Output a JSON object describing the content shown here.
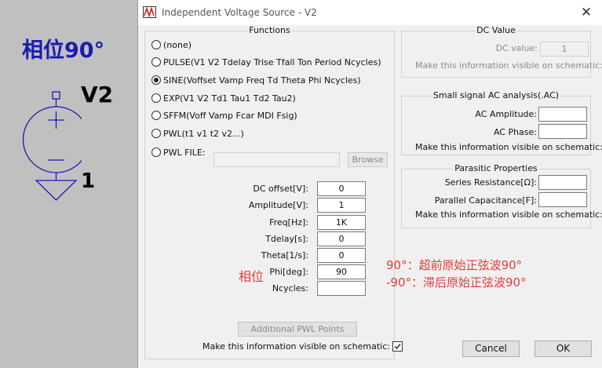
{
  "schematic": {
    "phase_label": "相位90°",
    "ref_designator": "V2",
    "node_label": "1"
  },
  "dialog": {
    "title": "Independent Voltage Source - V2",
    "close_glyph": "✕",
    "functions": {
      "title": "Functions",
      "options": [
        {
          "label": "(none)",
          "checked": false
        },
        {
          "label": "PULSE(V1 V2 Tdelay Trise Tfall Ton Period Ncycles)",
          "checked": false
        },
        {
          "label": "SINE(Voffset Vamp Freq Td Theta Phi Ncycles)",
          "checked": true
        },
        {
          "label": "EXP(V1 V2 Td1 Tau1 Td2 Tau2)",
          "checked": false
        },
        {
          "label": "SFFM(Voff Vamp Fcar MDI Fsig)",
          "checked": false
        },
        {
          "label": "PWL(t1 v1 t2 v2...)",
          "checked": false
        },
        {
          "label": "PWL FILE:",
          "checked": false
        }
      ],
      "browse_label": "Browse",
      "params": [
        {
          "label": "DC offset[V]:",
          "value": "0"
        },
        {
          "label": "Amplitude[V]:",
          "value": "1"
        },
        {
          "label": "Freq[Hz]:",
          "value": "1K"
        },
        {
          "label": "Tdelay[s]:",
          "value": "0"
        },
        {
          "label": "Theta[1/s]:",
          "value": "0"
        },
        {
          "label": "Phi[deg]:",
          "value": "90"
        },
        {
          "label": "Ncycles:",
          "value": ""
        }
      ],
      "additional_pwl_label": "Additional PWL Points",
      "visible_label": "Make this information visible on schematic:"
    },
    "dc_value": {
      "title": "DC Value",
      "label": "DC value:",
      "value": "1",
      "visible_label": "Make this information visible on schematic:"
    },
    "ac_analysis": {
      "title": "Small signal AC analysis(.AC)",
      "amplitude_label": "AC Amplitude:",
      "amplitude_value": "",
      "phase_label": "AC Phase:",
      "phase_value": "",
      "visible_label": "Make this information visible on schematic:"
    },
    "parasitic": {
      "title": "Parasitic Properties",
      "series_label": "Series Resistance[Ω]:",
      "series_value": "",
      "parallel_label": "Parallel Capacitance[F]:",
      "parallel_value": "",
      "visible_label": "Make this information visible on schematic:"
    },
    "cancel_label": "Cancel",
    "ok_label": "OK"
  },
  "annotations": {
    "phase_note": "相位",
    "line1": "90°：超前原始正弦波90°",
    "line2": "-90°：滞后原始正弦波90°",
    "color": "#e03c3c"
  }
}
